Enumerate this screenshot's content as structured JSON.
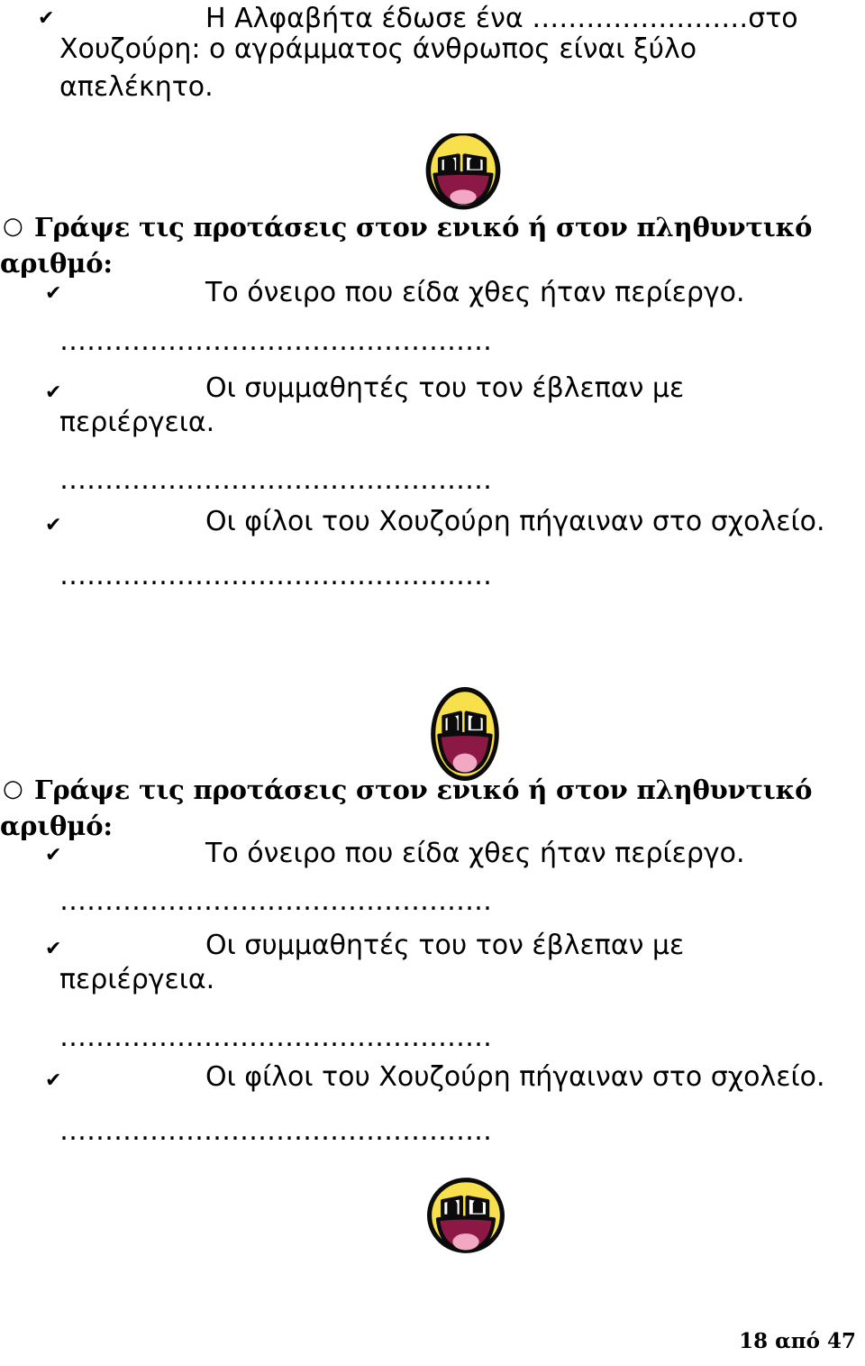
{
  "document": {
    "language": "Greek",
    "page_footer": "18 από 47"
  },
  "colors": {
    "face_fill": "#F7E04B",
    "outline": "#0B0B0B",
    "mouth": "#8C1845",
    "tongue": "#F2A7C3",
    "eye_white": "#FFFFFF",
    "text": "#000000",
    "background": "#FFFFFF"
  },
  "icons": {
    "check_bullet": "✔",
    "circle_bullet": "○"
  },
  "blocks": {
    "intro_item": {
      "bullet": "✔",
      "text": "Η Αλφαβήτα έδωσε ένα ……………………στο Χουζούρη: ο αγράμματος άνθρωπος είναι ξύλο απελέκητο.",
      "line1": "Η Αλφαβήτα έδωσε ένα ……………………στο",
      "line2": "Χουζούρη: ο αγράμματος άνθρωπος είναι ξύλο",
      "line3": "απελέκητο."
    },
    "dotted_line": "………………………………………………"
  },
  "sections": [
    {
      "id": "section-1",
      "heading_bullet": "○",
      "heading": "Γράψε τις προτάσεις στον ενικό ή στον πληθυντικό αριθμό:",
      "heading_line1": "Γράψε τις προτάσεις στον ενικό ή στον πληθυντικό",
      "heading_line2": "αριθμό:",
      "items": [
        {
          "bullet": "✔",
          "text": "Το όνειρο που είδα χθες ήταν περίεργο.",
          "answer_line": "…………………………………………"
        },
        {
          "bullet": "✔",
          "text": "Οι συμμαθητές του τον έβλεπαν με περιέργεια.",
          "line1": "Οι συμμαθητές του τον έβλεπαν με",
          "line2": "περιέργεια.",
          "answer_line": "…………………………………………"
        },
        {
          "bullet": "✔",
          "text": "Οι φίλοι του Χουζούρη πήγαιναν στο σχολείο.",
          "answer_line": "…………………………………………"
        }
      ]
    },
    {
      "id": "section-2",
      "heading_bullet": "○",
      "heading": "Γράψε τις προτάσεις στον ενικό ή στον πληθυντικό αριθμό:",
      "heading_line1": "Γράψε τις προτάσεις στον ενικό ή στον πληθυντικό",
      "heading_line2": "αριθμό:",
      "items": [
        {
          "bullet": "✔",
          "text": "Το όνειρο που είδα χθες ήταν περίεργο.",
          "answer_line": "…………………………………………"
        },
        {
          "bullet": "✔",
          "text": "Οι συμμαθητές του τον έβλεπαν με περιέργεια.",
          "line1": "Οι συμμαθητές του τον έβλεπαν με",
          "line2": "περιέργεια.",
          "answer_line": "…………………………………………"
        },
        {
          "bullet": "✔",
          "text": "Οι φίλοι του Χουζούρη πήγαιναν στο σχολείο.",
          "answer_line": "…………………………………………"
        }
      ]
    }
  ],
  "images": [
    {
      "id": "smiley-1",
      "name": "awesome-face-smiley",
      "description": "Awesome Face smiley, top cropped"
    },
    {
      "id": "smiley-2",
      "name": "awesome-face-smiley",
      "description": "Awesome Face smiley, oval"
    },
    {
      "id": "smiley-3",
      "name": "awesome-face-smiley",
      "description": "Awesome Face smiley, round"
    }
  ]
}
